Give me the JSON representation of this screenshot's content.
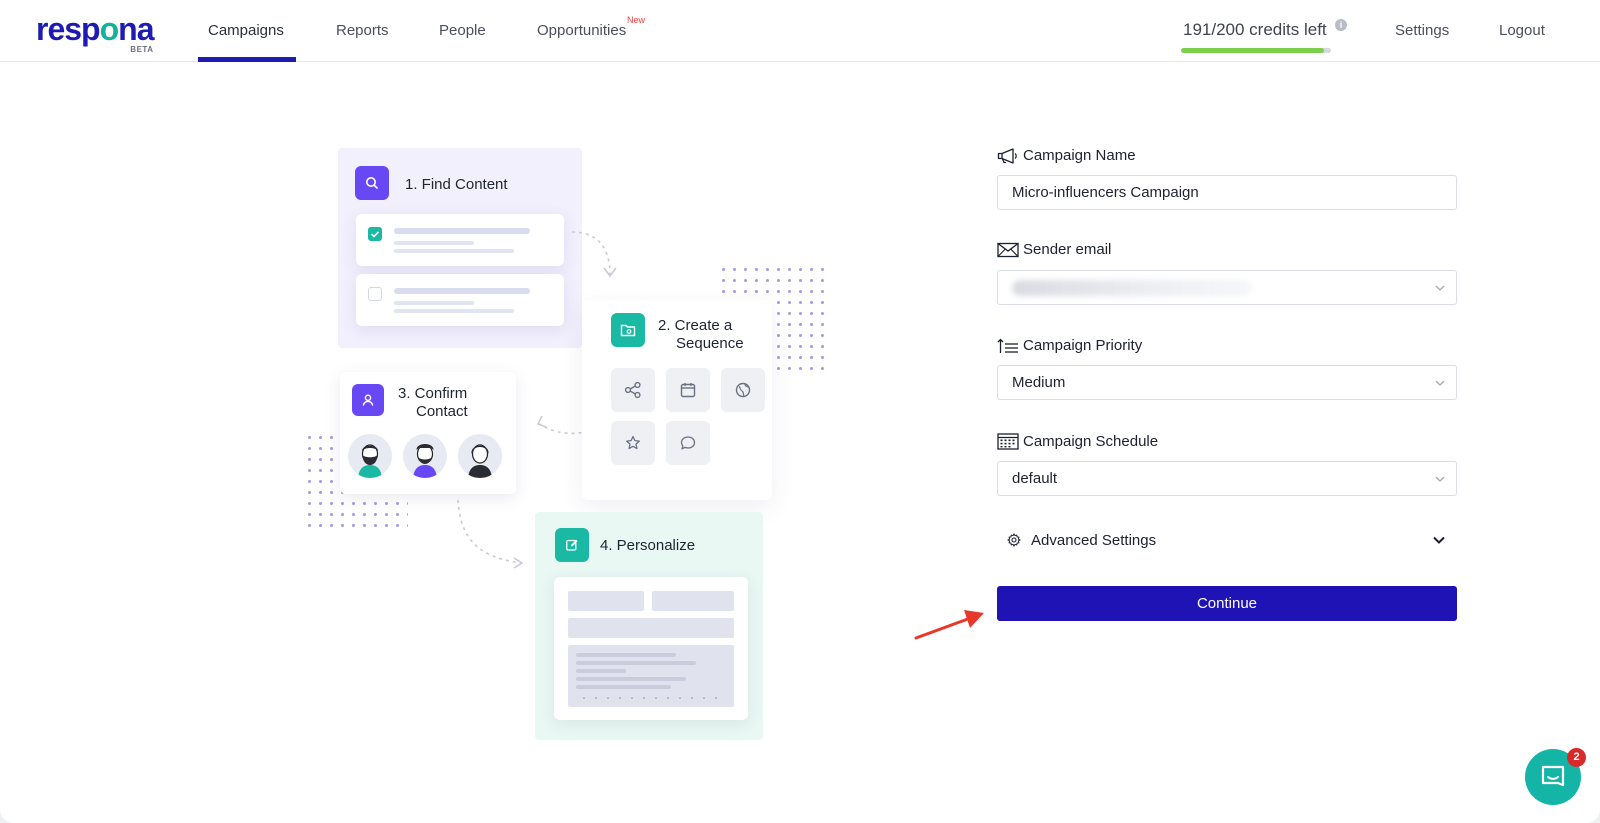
{
  "brand": {
    "name_part1": "resp",
    "name_o": "o",
    "name_part2": "na",
    "badge": "BETA"
  },
  "nav": {
    "items": [
      {
        "label": "Campaigns",
        "active": true
      },
      {
        "label": "Reports"
      },
      {
        "label": "People"
      },
      {
        "label": "Opportunities",
        "badge": "New"
      }
    ],
    "credits_text": "191/200 credits left",
    "credits_fraction": 0.955,
    "info_icon": "i",
    "settings": "Settings",
    "logout": "Logout"
  },
  "illustration": {
    "steps": [
      {
        "label": "1. Find Content",
        "icon": "search-icon"
      },
      {
        "label_line1": "2.  Create a",
        "label_line2": "Sequence",
        "icon": "folder-icon"
      },
      {
        "label_line1": "3.  Confirm",
        "label_line2": "Contact",
        "icon": "user-icon"
      },
      {
        "label": "4. Personalize",
        "icon": "edit-icon"
      }
    ]
  },
  "form": {
    "campaign_name_label": "Campaign Name",
    "campaign_name_value": "Micro-influencers Campaign",
    "sender_email_label": "Sender email",
    "campaign_priority_label": "Campaign Priority",
    "campaign_priority_value": "Medium",
    "campaign_schedule_label": "Campaign Schedule",
    "campaign_schedule_value": "default",
    "advanced_settings_label": "Advanced Settings",
    "continue_label": "Continue"
  },
  "chat": {
    "unread_count": "2"
  },
  "colors": {
    "primary": "#1f13b5",
    "teal": "#19b9a3",
    "purple": "#6848f5",
    "credits_green": "#7cd04b",
    "arrow_red": "#e8382b"
  }
}
